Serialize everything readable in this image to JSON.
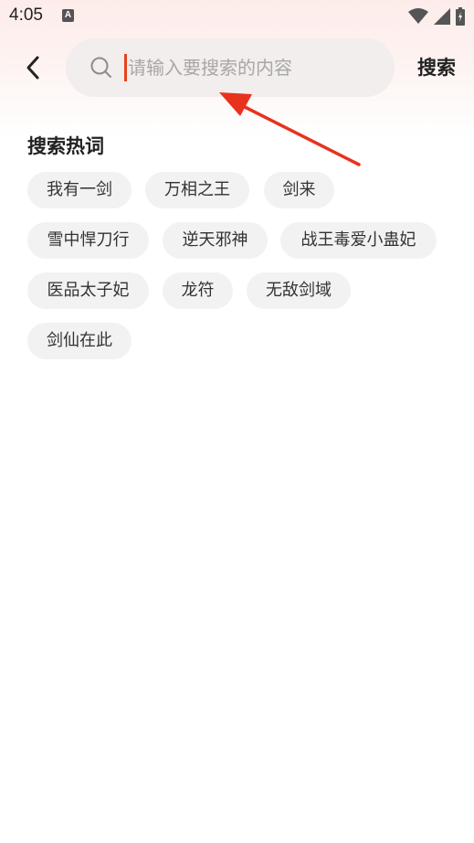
{
  "status_bar": {
    "time": "4:05",
    "a_icon": "A",
    "icons": [
      "notification-a-icon",
      "wifi-icon",
      "signal-icon",
      "battery-icon"
    ]
  },
  "header": {
    "back_icon": "chevron-left-icon",
    "search_icon": "search-icon",
    "search_placeholder": "请输入要搜索的内容",
    "search_value": "",
    "search_button": "搜索"
  },
  "hot_words": {
    "title": "搜索热词",
    "tags": [
      "我有一剑",
      "万相之王",
      "剑来",
      "雪中悍刀行",
      "逆天邪神",
      "战王毒爱小蛊妃",
      "医品太子妃",
      "龙符",
      "无敌剑域",
      "剑仙在此"
    ]
  },
  "colors": {
    "accent": "#e8431d",
    "arrow": "#e8321f",
    "tag_bg": "#f2f2f3",
    "search_bg": "#f1eeed"
  }
}
